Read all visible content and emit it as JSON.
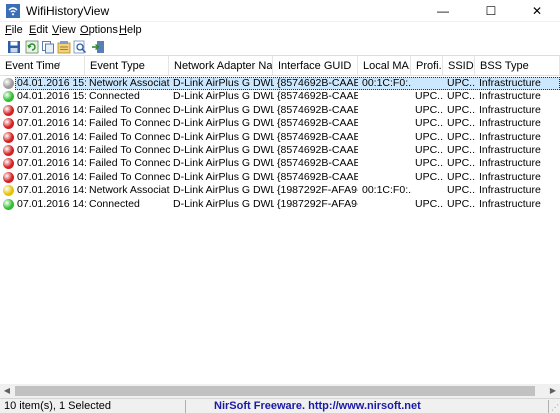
{
  "window": {
    "title": "WifiHistoryView",
    "minimize_glyph": "—",
    "maximize_glyph": "☐",
    "close_glyph": "✕"
  },
  "menu": [
    {
      "label": "File",
      "accel": "F",
      "rest": "ile"
    },
    {
      "label": "Edit",
      "accel": "E",
      "rest": "dit"
    },
    {
      "label": "View",
      "accel": "V",
      "rest": "iew"
    },
    {
      "label": "Options",
      "accel": "O",
      "rest": "ptions"
    },
    {
      "label": "Help",
      "accel": "H",
      "rest": "elp"
    }
  ],
  "toolbar": {
    "buttons": [
      "save-icon",
      "refresh-icon",
      "copy-icon",
      "properties-icon",
      "find-icon",
      "exit-icon"
    ]
  },
  "columns": [
    {
      "label": "Event Time"
    },
    {
      "label": "Event Type"
    },
    {
      "label": "Network Adapter Name"
    },
    {
      "label": "Interface GUID"
    },
    {
      "label": "Local MA..."
    },
    {
      "label": "Profi..."
    },
    {
      "label": "SSID"
    },
    {
      "label": "BSS Type"
    }
  ],
  "sort": {
    "column": "Event Time",
    "glyph": "/"
  },
  "status_colors": {
    "grey": "#9a9a9a",
    "green": "#2fbf2f",
    "red": "#d42020",
    "yellow": "#e6c200"
  },
  "rows": [
    {
      "status": "grey",
      "time": "04.01.2016 15:02:...",
      "type": "Network Associati...",
      "adapter": "D-Link AirPlus G DWL-G...",
      "guid": "{8574692B-CAAE-4...",
      "mac": "00:1C:F0:...",
      "profile": "",
      "ssid": "UPC...",
      "bss": "Infrastructure"
    },
    {
      "status": "green",
      "time": "04.01.2016 15:02:...",
      "type": "Connected",
      "adapter": "D-Link AirPlus G DWL-G...",
      "guid": "{8574692B-CAAE-4...",
      "mac": "",
      "profile": "UPC...",
      "ssid": "UPC...",
      "bss": "Infrastructure"
    },
    {
      "status": "red",
      "time": "07.01.2016 14:56:...",
      "type": "Failed To Connect",
      "adapter": "D-Link AirPlus G DWL-G...",
      "guid": "{8574692B-CAAE-4...",
      "mac": "",
      "profile": "UPC...",
      "ssid": "UPC...",
      "bss": "Infrastructure"
    },
    {
      "status": "red",
      "time": "07.01.2016 14:56:...",
      "type": "Failed To Connect",
      "adapter": "D-Link AirPlus G DWL-G...",
      "guid": "{8574692B-CAAE-4...",
      "mac": "",
      "profile": "UPC...",
      "ssid": "UPC...",
      "bss": "Infrastructure"
    },
    {
      "status": "red",
      "time": "07.01.2016 14:56:...",
      "type": "Failed To Connect",
      "adapter": "D-Link AirPlus G DWL-G...",
      "guid": "{8574692B-CAAE-4...",
      "mac": "",
      "profile": "UPC...",
      "ssid": "UPC...",
      "bss": "Infrastructure"
    },
    {
      "status": "red",
      "time": "07.01.2016 14:56:...",
      "type": "Failed To Connect",
      "adapter": "D-Link AirPlus G DWL-G...",
      "guid": "{8574692B-CAAE-4...",
      "mac": "",
      "profile": "UPC...",
      "ssid": "UPC...",
      "bss": "Infrastructure"
    },
    {
      "status": "red",
      "time": "07.01.2016 14:56:...",
      "type": "Failed To Connect",
      "adapter": "D-Link AirPlus G DWL-G...",
      "guid": "{8574692B-CAAE-4...",
      "mac": "",
      "profile": "UPC...",
      "ssid": "UPC...",
      "bss": "Infrastructure"
    },
    {
      "status": "red",
      "time": "07.01.2016 14:57:...",
      "type": "Failed To Connect",
      "adapter": "D-Link AirPlus G DWL-G...",
      "guid": "{8574692B-CAAE-4...",
      "mac": "",
      "profile": "UPC...",
      "ssid": "UPC...",
      "bss": "Infrastructure"
    },
    {
      "status": "yellow",
      "time": "07.01.2016 14:57:...",
      "type": "Network Associati...",
      "adapter": "D-Link AirPlus G DWL-G...",
      "guid": "{1987292F-AFA9-4...",
      "mac": "00:1C:F0:...",
      "profile": "",
      "ssid": "UPC...",
      "bss": "Infrastructure"
    },
    {
      "status": "green",
      "time": "07.01.2016 14:57:...",
      "type": "Connected",
      "adapter": "D-Link AirPlus G DWL-G...",
      "guid": "{1987292F-AFA9-4...",
      "mac": "",
      "profile": "UPC...",
      "ssid": "UPC...",
      "bss": "Infrastructure"
    }
  ],
  "selected_row": 0,
  "statusbar": {
    "count": "10 item(s), 1 Selected",
    "link": "NirSoft Freeware.  http://www.nirsoft.net"
  }
}
